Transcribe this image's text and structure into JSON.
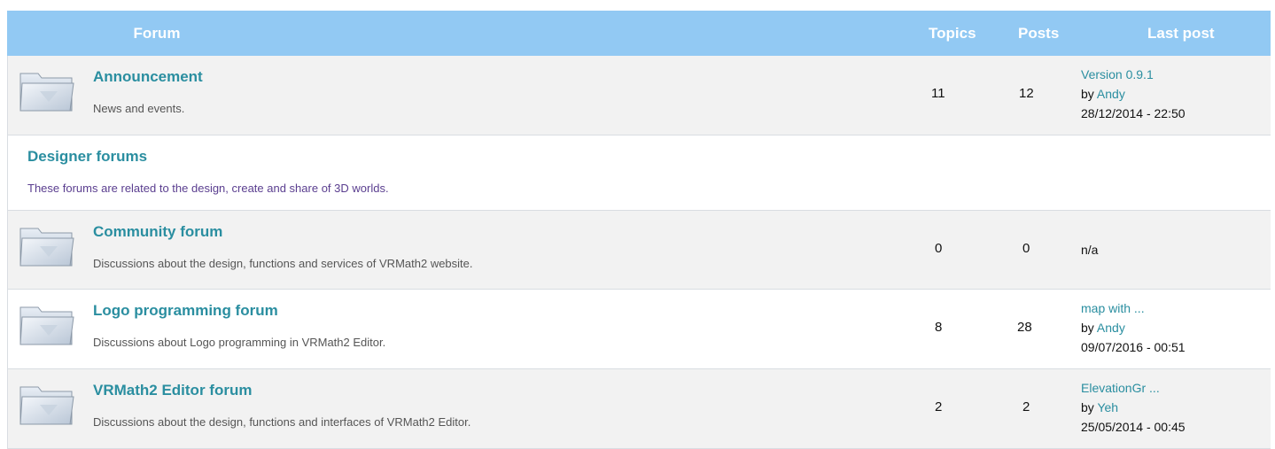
{
  "header": {
    "forum": "Forum",
    "topics": "Topics",
    "posts": "Posts",
    "last_post": "Last post"
  },
  "forums": [
    {
      "title": "Announcement",
      "description": "News and events.",
      "topics": "11",
      "posts": "12",
      "last": {
        "topic": "Version 0.9.1",
        "by": "by",
        "author": "Andy",
        "date": "28/12/2014 - 22:50"
      }
    },
    {
      "title": "Community forum",
      "description": "Discussions about the design, functions and services of VRMath2 website.",
      "topics": "0",
      "posts": "0",
      "last": {
        "na": "n/a"
      }
    },
    {
      "title": "Logo programming forum",
      "description": "Discussions about Logo programming in VRMath2 Editor.",
      "topics": "8",
      "posts": "28",
      "last": {
        "topic": "map with ...",
        "by": "by",
        "author": "Andy",
        "date": "09/07/2016 - 00:51"
      }
    },
    {
      "title": "VRMath2 Editor forum",
      "description": "Discussions about the design, functions and interfaces of VRMath2 Editor.",
      "topics": "2",
      "posts": "2",
      "last": {
        "topic": "ElevationGr ...",
        "by": "by",
        "author": "Yeh",
        "date": "25/05/2014 - 00:45"
      }
    }
  ],
  "category": {
    "title": "Designer forums",
    "description": "These forums are related to the design, create and share of 3D worlds."
  },
  "colors": {
    "header_bg": "#92c9f3",
    "link": "#2a8ea0",
    "row_gray": "#f2f2f2"
  },
  "icons": {
    "folder": "folder-icon"
  }
}
